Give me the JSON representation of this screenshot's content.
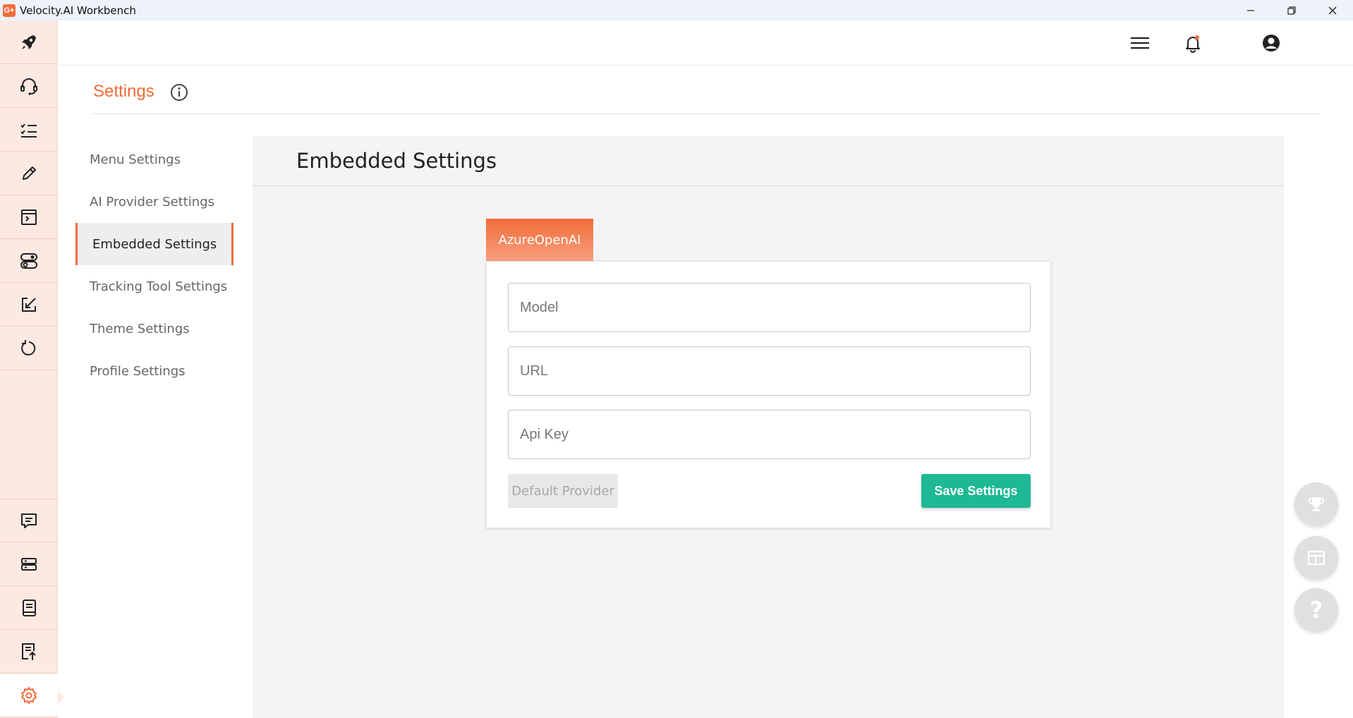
{
  "window": {
    "title": "Velocity.AI Workbench",
    "app_icon_text": "G+"
  },
  "rail": {
    "top_items": [
      "rocket-icon",
      "headset-icon",
      "checklist-icon",
      "pencil-icon",
      "terminal-window-icon",
      "toggle-icon",
      "export-icon",
      "refresh-icon"
    ],
    "bottom_items": [
      "chat-icon",
      "server-icon",
      "notebook-icon",
      "document-upload-icon",
      "gear-icon"
    ],
    "active": "gear-icon"
  },
  "header": {
    "icons": [
      "menu-icon",
      "bell-icon",
      "user-account-icon"
    ]
  },
  "page": {
    "title": "Settings"
  },
  "settings_menu": {
    "items": [
      {
        "label": "Menu Settings"
      },
      {
        "label": "AI Provider Settings"
      },
      {
        "label": "Embedded Settings"
      },
      {
        "label": "Tracking Tool Settings"
      },
      {
        "label": "Theme Settings"
      },
      {
        "label": "Profile Settings"
      }
    ],
    "active_index": 2
  },
  "panel": {
    "title": "Embedded Settings",
    "tab_label": "AzureOpenAI",
    "fields": {
      "model": {
        "placeholder": "Model",
        "value": ""
      },
      "url": {
        "placeholder": "URL",
        "value": ""
      },
      "api_key": {
        "placeholder": "Api Key",
        "value": ""
      }
    },
    "default_provider_label": "Default Provider",
    "save_label": "Save Settings"
  },
  "colors": {
    "accent": "#f26b3a",
    "save": "#1fb894",
    "rail_bg": "#fde9e1",
    "panel_bg": "#f4f4f4"
  },
  "floating_buttons": [
    "trophy-icon",
    "layout-icon",
    "help-icon"
  ],
  "help_glyph": "?"
}
